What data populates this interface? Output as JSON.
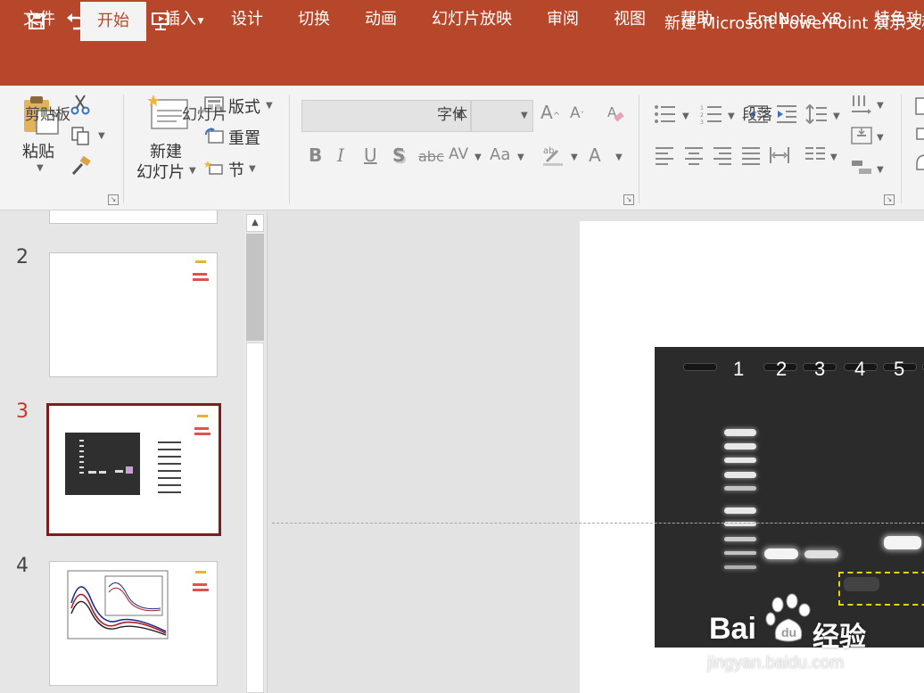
{
  "window": {
    "title": "新建 Microsoft PowerPoint 演示文稿"
  },
  "tabs": [
    "文件",
    "开始",
    "插入",
    "设计",
    "切换",
    "动画",
    "幻灯片放映",
    "审阅",
    "视图",
    "帮助",
    "EndNote X8",
    "特色功"
  ],
  "active_tab": "开始",
  "ribbon": {
    "clipboard": {
      "paste_label": "粘贴",
      "group_label": "剪贴板"
    },
    "slides": {
      "new_slide_line1": "新建",
      "new_slide_line2": "幻灯片",
      "layout_label": "版式",
      "reset_label": "重置",
      "section_label": "节",
      "group_label": "幻灯片"
    },
    "font": {
      "group_label": "字体"
    },
    "paragraph": {
      "group_label": "段落"
    }
  },
  "slide_panel": {
    "thumbnails": [
      {
        "number": "2",
        "selected": false
      },
      {
        "number": "3",
        "selected": true
      },
      {
        "number": "4",
        "selected": false
      }
    ]
  },
  "gel": {
    "lane_labels": [
      "1",
      "2",
      "3",
      "4",
      "5"
    ]
  },
  "watermark": {
    "brand": "Bai",
    "brand_cn": "经验",
    "url": "jingyan.baidu.com"
  }
}
